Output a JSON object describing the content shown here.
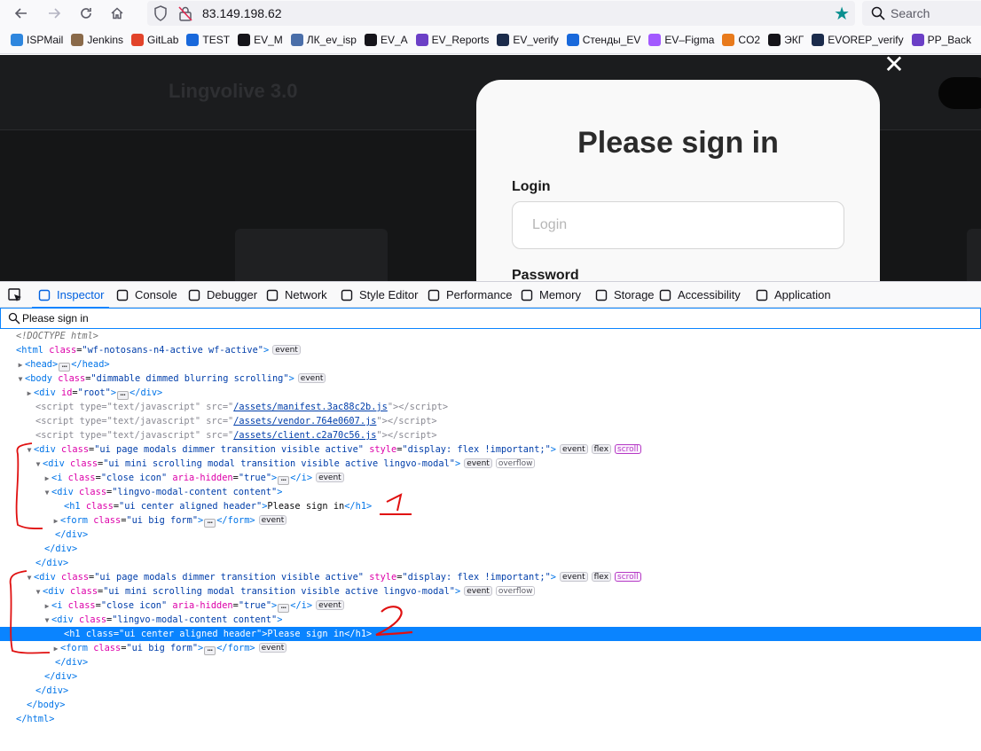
{
  "browser": {
    "url": "83.149.198.62",
    "search_placeholder": "Search",
    "bookmarks": [
      {
        "label": "ISPMail",
        "icon": "mail-icon",
        "color": "#2e86de"
      },
      {
        "label": "Jenkins",
        "icon": "jenkins-icon",
        "color": "#8a6a4a"
      },
      {
        "label": "GitLab",
        "icon": "gitlab-icon",
        "color": "#e2432a"
      },
      {
        "label": "TEST",
        "icon": "confluence-icon",
        "color": "#1868db"
      },
      {
        "label": "EV_M",
        "icon": "ev-icon",
        "color": "#15141a"
      },
      {
        "label": "ЛК_ev_isp",
        "icon": "globe-icon",
        "color": "#4a6ea9"
      },
      {
        "label": "EV_A",
        "icon": "ev-icon",
        "color": "#15141a"
      },
      {
        "label": "EV_Reports",
        "icon": "globe-icon",
        "color": "#6b3fc6"
      },
      {
        "label": "EV_verify",
        "icon": "jira-icon",
        "color": "#1b2b4b"
      },
      {
        "label": "Стенды_EV",
        "icon": "confluence-icon",
        "color": "#1868db"
      },
      {
        "label": "EV–Figma",
        "icon": "figma-icon",
        "color": "#a259ff"
      },
      {
        "label": "CO2",
        "icon": "co2-icon",
        "color": "#e87a1c"
      },
      {
        "label": "ЭКГ",
        "icon": "triangle-icon",
        "color": "#15141a"
      },
      {
        "label": "EVOREP_verify",
        "icon": "jira-icon",
        "color": "#1b2b4b"
      },
      {
        "label": "PP_Back",
        "icon": "globe-icon",
        "color": "#6b3fc6"
      }
    ]
  },
  "page": {
    "bg_title": "Lingvolive 3.0"
  },
  "modal": {
    "title": "Please sign in",
    "login_label": "Login",
    "login_placeholder": "Login",
    "password_label": "Password"
  },
  "devtools": {
    "tabs": [
      {
        "label": "Inspector",
        "icon": "inspector-icon"
      },
      {
        "label": "Console",
        "icon": "console-icon"
      },
      {
        "label": "Debugger",
        "icon": "debugger-icon"
      },
      {
        "label": "Network",
        "icon": "network-icon"
      },
      {
        "label": "Style Editor",
        "icon": "style-editor-icon"
      },
      {
        "label": "Performance",
        "icon": "performance-icon"
      },
      {
        "label": "Memory",
        "icon": "memory-icon"
      },
      {
        "label": "Storage",
        "icon": "storage-icon"
      },
      {
        "label": "Accessibility",
        "icon": "accessibility-icon"
      },
      {
        "label": "Application",
        "icon": "application-icon"
      }
    ],
    "search_value": "Please sign in",
    "markup": {
      "doctype": "<!DOCTYPE html>",
      "html_class": "wf-notosans-n4-active wf-active",
      "body_class": "dimmable dimmed blurring scrolling",
      "root_id": "root",
      "scripts": [
        {
          "type": "text/javascript",
          "src": "/assets/manifest.3ac88c2b.js"
        },
        {
          "type": "text/javascript",
          "src": "/assets/vendor.764e0607.js"
        },
        {
          "type": "text/javascript",
          "src": "/assets/client.c2a70c56.js"
        }
      ],
      "dimmer_class": "ui page modals dimmer transition visible active",
      "dimmer_style": "display: flex !important;",
      "modal_class": "ui mini scrolling modal transition visible active lingvo-modal",
      "close_class": "close icon",
      "aria_hidden": "true",
      "content_class": "lingvo-modal-content content",
      "h1_class": "ui center aligned header",
      "h1_text": "Please sign in",
      "form_class": "ui big form",
      "badges": {
        "event": "event",
        "flex": "flex",
        "scroll": "scroll",
        "overflow": "overflow"
      }
    }
  },
  "annotations": {
    "first": "1",
    "second": "2",
    "color": "#e01010"
  }
}
